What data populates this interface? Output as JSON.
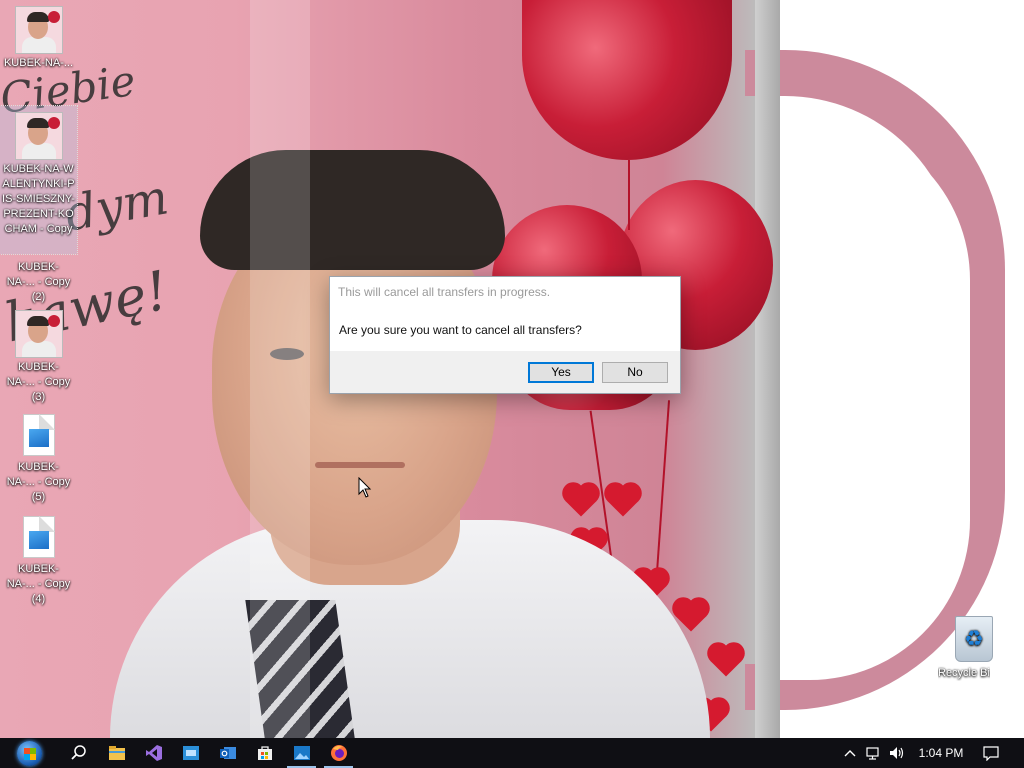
{
  "desktop": {
    "icons": [
      {
        "label": "KUBEK-NA-...",
        "type": "image-thumb"
      },
      {
        "label": "KUBEK-NA-WALENTYNKI-PIS-SMIESZNY-PREZENT-KOCHAM - Copy",
        "type": "image-thumb",
        "selected": true
      },
      {
        "label": "KUBEK-NA-... - Copy (2)",
        "type": "image-thumb"
      },
      {
        "label": "KUBEK-NA-... - Copy (3)",
        "type": "image-thumb"
      },
      {
        "label": "KUBEK-NA-... - Copy (5)",
        "type": "image-file"
      },
      {
        "label": "KUBEK-NA-... - Copy (4)",
        "type": "image-file"
      }
    ],
    "recycle_bin": {
      "label": "Recycle Bin",
      "icon": "recycle-bin-icon"
    },
    "wallpaper_text": {
      "line1": "Ciebie",
      "line2": "dym",
      "line3": "kawę!"
    }
  },
  "dialog": {
    "title": "This will cancel all transfers in progress.",
    "message": "Are you sure you want to cancel all transfers?",
    "yes_label": "Yes",
    "no_label": "No"
  },
  "taskbar": {
    "apps": [
      {
        "name": "search-icon"
      },
      {
        "name": "file-explorer-icon"
      },
      {
        "name": "visual-studio-icon"
      },
      {
        "name": "app-icon"
      },
      {
        "name": "outlook-icon"
      },
      {
        "name": "store-icon"
      },
      {
        "name": "photos-icon",
        "active": true
      },
      {
        "name": "firefox-icon",
        "active": true
      }
    ],
    "clock": "1:04 PM"
  },
  "colors": {
    "accent": "#0078d7",
    "taskbar": "#0f0f14",
    "dialog_footer": "#f0f0f0"
  }
}
